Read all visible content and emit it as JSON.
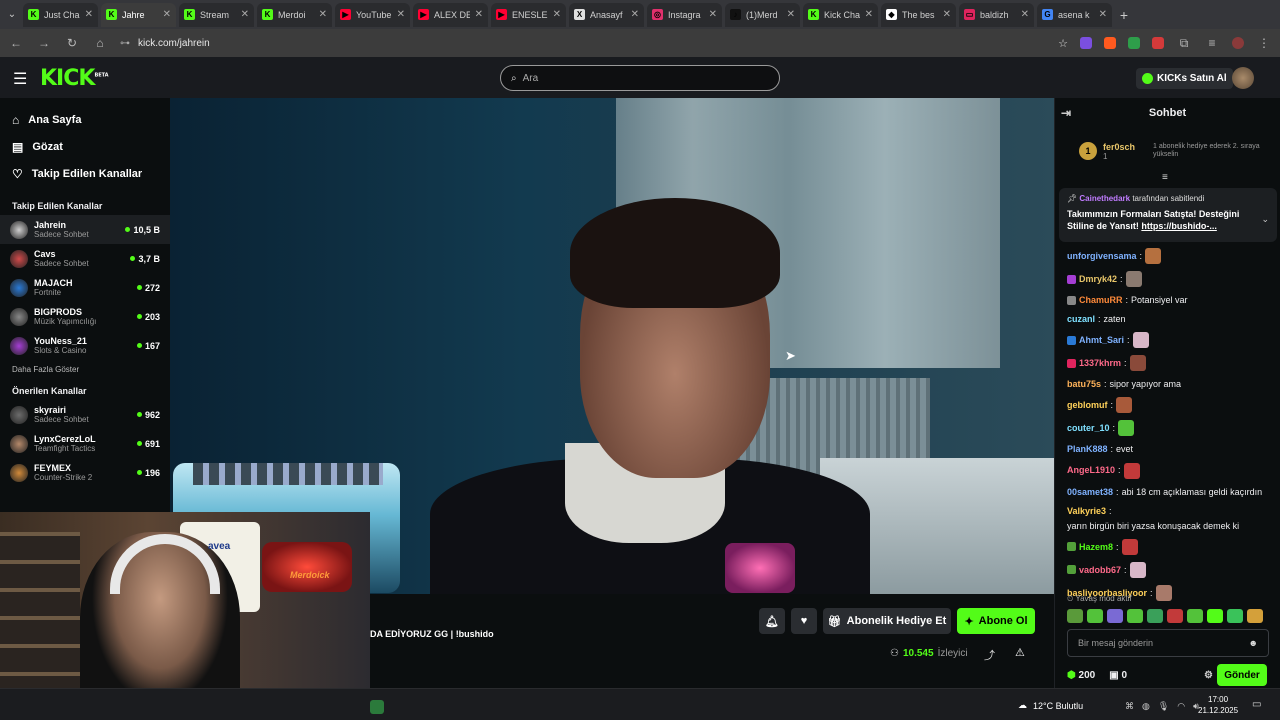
{
  "browser": {
    "tabs": [
      {
        "label": "Just Cha",
        "color": "#53fc18",
        "glyph": "K"
      },
      {
        "label": "Jahre",
        "color": "#53fc18",
        "glyph": "K",
        "active": true
      },
      {
        "label": "Stream",
        "color": "#53fc18",
        "glyph": "K"
      },
      {
        "label": "Merdoi",
        "color": "#53fc18",
        "glyph": "K"
      },
      {
        "label": "YouTube",
        "color": "#ff0033",
        "glyph": "▶"
      },
      {
        "label": "ALEX DE",
        "color": "#ff0033",
        "glyph": "▶"
      },
      {
        "label": "ENESLE",
        "color": "#ff0033",
        "glyph": "▶"
      },
      {
        "label": "Anasayf",
        "color": "#e0e0e0",
        "glyph": "X"
      },
      {
        "label": "Instagra",
        "color": "#e1306c",
        "glyph": "◎"
      },
      {
        "label": "(1)Merd",
        "color": "#111111",
        "glyph": "♪"
      },
      {
        "label": "Kick Cha",
        "color": "#53fc18",
        "glyph": "K"
      },
      {
        "label": "The bes",
        "color": "#ffffff",
        "glyph": "◆"
      },
      {
        "label": "baldizh",
        "color": "#e0245e",
        "glyph": "▭"
      },
      {
        "label": "asena k",
        "color": "#4285f4",
        "glyph": "G"
      }
    ],
    "url": "kick.com/jahrein"
  },
  "header": {
    "logo": "KICK",
    "logo_sup": "BETA",
    "search_placeholder": "Ara",
    "kicks_button": "KICKs Satın Al"
  },
  "sidebar": {
    "nav": [
      {
        "label": "Ana Sayfa",
        "icon": "⌂"
      },
      {
        "label": "Gözat",
        "icon": "▤"
      },
      {
        "label": "Takip Edilen Kanallar",
        "icon": "♡"
      }
    ],
    "followed_title": "Takip Edilen Kanallar",
    "followed": [
      {
        "name": "Jahrein",
        "game": "Sadece Sohbet",
        "viewers": "10,5 B",
        "color": "#cfcfcf"
      },
      {
        "name": "Cavs",
        "game": "Sadece Sohbet",
        "viewers": "3,7 B",
        "color": "#d14a4a"
      },
      {
        "name": "MAJACH",
        "game": "Fortnite",
        "viewers": "272",
        "color": "#2a7ad6"
      },
      {
        "name": "BIGPRODS",
        "game": "Müzik Yapımcılığı",
        "viewers": "203",
        "color": "#888888"
      },
      {
        "name": "YouNess_21",
        "game": "Slots & Casino",
        "viewers": "167",
        "color": "#a53ed4"
      }
    ],
    "show_more": "Daha Fazla Göster",
    "recommended_title": "Önerilen Kanallar",
    "recommended": [
      {
        "name": "skyrairi",
        "game": "Sadece Sohbet",
        "viewers": "962",
        "color": "#6c6c6c"
      },
      {
        "name": "LynxCerezLoL",
        "game": "Teamfight Tactics",
        "viewers": "691",
        "color": "#b5896a"
      },
      {
        "name": "FEYMEX",
        "game": "Counter-Strike 2",
        "viewers": "196",
        "color": "#d18a3a"
      }
    ]
  },
  "stream": {
    "title_fragment": "DA EDİYORUZ GG | !bushido",
    "gift_sub_button": "Abonelik Hediye Et",
    "subscribe_button": "Abone Ol",
    "viewer_count": "10.545",
    "viewer_label": "İzleyici",
    "overlay_text": "Merdoick",
    "jersey_text": "avea"
  },
  "chat": {
    "title": "Sohbet",
    "leader": {
      "rank": "1",
      "name": "fer0sch",
      "count": "1",
      "gift_text": "1 abonelik hediye ederek 2. sıraya yükselin"
    },
    "pinned": {
      "by": "Cainethedark",
      "by_suffix": "tarafından sabitlendi",
      "message": "Takımımızın Formaları Satışta! Desteğini Stiline de Yansıt! ",
      "link": "https://bushido-..."
    },
    "messages": [
      {
        "user": "unforgivensama",
        "color": "#7fb2ff",
        "text": "",
        "emote": "#b5703f"
      },
      {
        "user": "Dmryk42",
        "color": "#e8c66a",
        "text": "",
        "emote": "#8a7a70",
        "badge": "#a53ed4"
      },
      {
        "user": "ChamuRR",
        "color": "#ff8a3a",
        "text": "Potansiyel var",
        "badge": "#888"
      },
      {
        "user": "cuzanl",
        "color": "#7fe0ff",
        "text": "zaten"
      },
      {
        "user": "Ahmt_Sari",
        "color": "#7fb2ff",
        "text": "",
        "emote": "#d8b7c8",
        "badge": "#2a7ad6"
      },
      {
        "user": "1337khrm",
        "color": "#ff6a8a",
        "text": "",
        "emote": "#8a4a3a",
        "badge": "#e0245e"
      },
      {
        "user": "batu75s",
        "color": "#ffb35a",
        "text": "sipor yapıyor ama"
      },
      {
        "user": "geblomuf",
        "color": "#ffd15a",
        "text": "",
        "emote": "#a85a3a"
      },
      {
        "user": "couter_10",
        "color": "#7fe0ff",
        "text": "",
        "emote": "#53c23a"
      },
      {
        "user": "PlanK888",
        "color": "#7fb2ff",
        "text": "evet"
      },
      {
        "user": "AngeL1910",
        "color": "#ff6a8a",
        "text": "",
        "emote": "#c23a3a"
      },
      {
        "user": "00samet38",
        "color": "#7fb2ff",
        "text": "abi 18 cm açıklaması geldi kaçırdın"
      },
      {
        "user": "Valkyrie3",
        "color": "#ffd15a",
        "text": "yarın birgün biri yazsa konuşacak demek ki"
      },
      {
        "user": "Hazem8",
        "color": "#53fc18",
        "text": "",
        "emote": "#c23a3a",
        "badge": "#53a03a"
      },
      {
        "user": "vadobb67",
        "color": "#ff6a8a",
        "text": "",
        "emote": "#d8b7c8",
        "badge": "#53a03a"
      },
      {
        "user": "basliyoorbasliyoor",
        "color": "#ffd15a",
        "text": "",
        "emote": "#a87a6a"
      }
    ],
    "slow_mode": "Yavaş mod aktif",
    "input_placeholder": "Bir mesaj gönderin",
    "points": "200",
    "gifts": "0",
    "send_button": "Gönder"
  },
  "taskbar": {
    "weather": "12°C Bulutlu",
    "time": "17:00",
    "date": "21.12.2025"
  },
  "colors": {
    "accent": "#53fc18",
    "bg": "#0b0e0f"
  }
}
